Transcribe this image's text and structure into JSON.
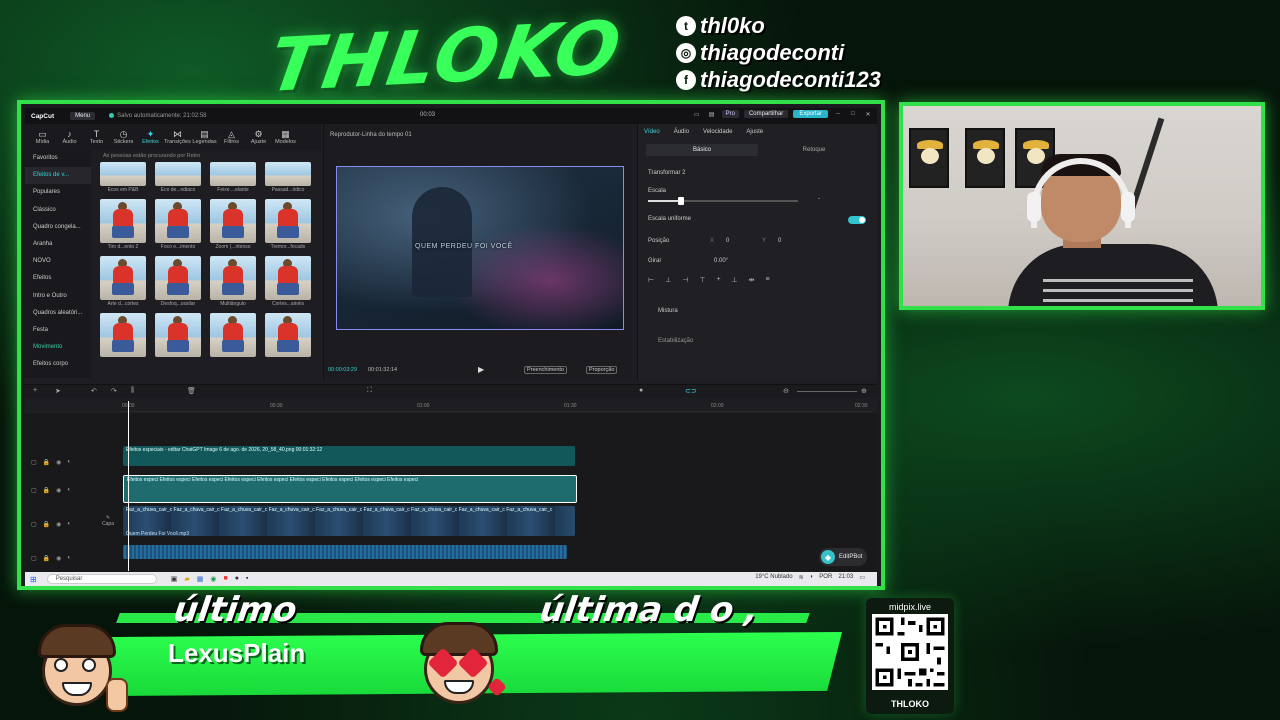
{
  "overlay": {
    "logo_text": "THLOKO",
    "socials": [
      {
        "icon": "twitter-icon",
        "glyph": "t",
        "handle": "thl0ko"
      },
      {
        "icon": "instagram-icon",
        "glyph": "◎",
        "handle": "thiagodeconti"
      },
      {
        "icon": "facebook-icon",
        "glyph": "f",
        "handle": "thiagodeconti123"
      }
    ],
    "banner_left_title": "último",
    "banner_right_title": "última d o ,",
    "banner_name": "LexusPlain",
    "qr_top": "midpix.live",
    "qr_bottom": "THLOKO"
  },
  "capcut": {
    "title_bar": {
      "app_name": "CapCut",
      "menu": "Menu",
      "autosave": "Salvo automaticamente: 21:02:58",
      "center_time": "00:03",
      "pro": "Pro",
      "share": "Compartilhar",
      "export": "Exportar"
    },
    "tools": [
      {
        "icon": "media-icon",
        "glyph": "▭",
        "label": "Mídia"
      },
      {
        "icon": "audio-icon",
        "glyph": "♪",
        "label": "Áudio"
      },
      {
        "icon": "text-icon",
        "glyph": "T",
        "label": "Texto"
      },
      {
        "icon": "stickers-icon",
        "glyph": "◷",
        "label": "Stickers"
      },
      {
        "icon": "effects-icon",
        "glyph": "✦",
        "label": "Efeitos"
      },
      {
        "icon": "transitions-icon",
        "glyph": "⋈",
        "label": "Transições"
      },
      {
        "icon": "captions-icon",
        "glyph": "▤",
        "label": "Legendas"
      },
      {
        "icon": "filters-icon",
        "glyph": "◬",
        "label": "Filtros"
      },
      {
        "icon": "adjust-icon",
        "glyph": "⚙",
        "label": "Ajuste"
      },
      {
        "icon": "templates-icon",
        "glyph": "▦",
        "label": "Modelos"
      }
    ],
    "sidebar": [
      "Favoritos",
      "Efeitos de v...",
      "Populares",
      "Clássico",
      "Quadro congela...",
      "Aranha",
      "NOVO",
      "Efeitos",
      "Intro e Outro",
      "Quadros aleatóri...",
      "Festa",
      "Movimento",
      "Efeitos corpo"
    ],
    "effects_header": "As pessoas estão procurando por Retro",
    "effects": [
      "Ecos em P&B",
      "Eco de...ndiaco",
      "Feixe ...elante",
      "Passad...ódico",
      "Tiro d...ento 2",
      "Foco e...imento",
      "Zoom (...ntenso",
      "Tremor...focado",
      "Arte d...cortes",
      "Desfoq...ossilar",
      "Multiângulo",
      "Cortes...ainéis",
      "",
      "",
      "",
      ""
    ],
    "player": {
      "title": "Reprodutor-Linha do tempo 01",
      "overlay_text": "QUEM PERDEU FOI VOCÊ",
      "current_time": "00:00:03:29",
      "total_time": "00:01:32:14",
      "fill_btn": "Preenchimento",
      "ratio_btn": "Proporção"
    },
    "inspector": {
      "tabs": [
        "Vídeo",
        "Áudio",
        "Velocidade",
        "Ajuste"
      ],
      "subtabs": [
        "Básico",
        "Retoque"
      ],
      "transform": "Transformar 2",
      "scale": "Escala",
      "scale_value": "-",
      "uniform_scale": "Escala uniforme",
      "position": "Posição",
      "pos_x_label": "X",
      "pos_x": "0",
      "pos_y_label": "Y",
      "pos_y": "0",
      "rotate": "Girar",
      "rotate_value": "0.00°",
      "mix": "Mistura",
      "stabilize": "Estabilização"
    },
    "ruler_ticks": [
      "00:00",
      "00:30",
      "01:00",
      "01:30",
      "02:00",
      "02:30"
    ],
    "clips": {
      "text_clip": "Efeitos especiais - editar ChatGPT Image 6 de ago. de 2026, 20_58_40.png  00:01:32:12",
      "fx_clip": "Efeitos especi Efeitos especi Efeitos especi Efeitos especi Efeitos especi Efeitos especi Efeitos especi Efeitos especi Efeitos especi",
      "video_clip": "Faz_a_chuva_cair_c Faz_a_chuva_cair_c Faz_a_chuva_cair_c Faz_a_chuva_cair_c Faz_a_chuva_cair_c Faz_a_chuva_cair_c Faz_a_chuva_cair_c Faz_a_chuva_cair_c Faz_a_chuva_cair_c",
      "audio_clip": "Quem Perdeu Foi Você.mp3",
      "cover_label": "Capa"
    },
    "editbot": "EditPBot"
  },
  "taskbar": {
    "search_placeholder": "Pesquisar",
    "weather": "19°C  Nublado",
    "lang": "POR",
    "clock": "21:03"
  },
  "colors": {
    "accent_green": "#32e04a",
    "capcut_accent": "#3ad4dc"
  }
}
